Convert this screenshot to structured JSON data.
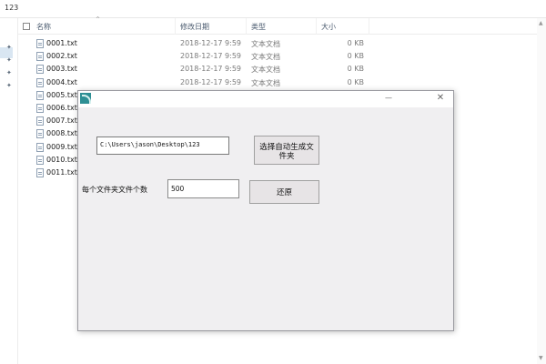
{
  "address": "123",
  "columns": {
    "name": "名称",
    "date": "修改日期",
    "type": "类型",
    "size": "大小"
  },
  "files": [
    {
      "name": "0001.txt",
      "date": "2018-12-17 9:59",
      "type": "文本文档",
      "size": "0 KB"
    },
    {
      "name": "0002.txt",
      "date": "2018-12-17 9:59",
      "type": "文本文档",
      "size": "0 KB"
    },
    {
      "name": "0003.txt",
      "date": "2018-12-17 9:59",
      "type": "文本文档",
      "size": "0 KB"
    },
    {
      "name": "0004.txt",
      "date": "2018-12-17 9:59",
      "type": "文本文档",
      "size": "0 KB"
    },
    {
      "name": "0005.txt",
      "date": "",
      "type": "",
      "size": ""
    },
    {
      "name": "0006.txt",
      "date": "",
      "type": "",
      "size": ""
    },
    {
      "name": "0007.txt",
      "date": "",
      "type": "",
      "size": ""
    },
    {
      "name": "0008.txt",
      "date": "",
      "type": "",
      "size": ""
    },
    {
      "name": "0009.txt",
      "date": "",
      "type": "",
      "size": ""
    },
    {
      "name": "0010.txt",
      "date": "",
      "type": "",
      "size": ""
    },
    {
      "name": "0011.txt",
      "date": "",
      "type": "",
      "size": ""
    }
  ],
  "dialog": {
    "path_value": "C:\\Users\\jason\\Desktop\\123",
    "select_button": "选择自动生成文件夹",
    "count_label": "每个文件夹文件个数",
    "count_value": "500",
    "restore_button": "还原",
    "minimize_glyph": "—",
    "close_glyph": "✕"
  },
  "icons": {
    "pin": "pin-icon",
    "file": "text-file-icon",
    "app": "app-icon"
  },
  "colors": {
    "dialog_bg": "#f0eff1",
    "app_icon": "#2e8f94",
    "nav_selected": "#d9e6f2"
  }
}
